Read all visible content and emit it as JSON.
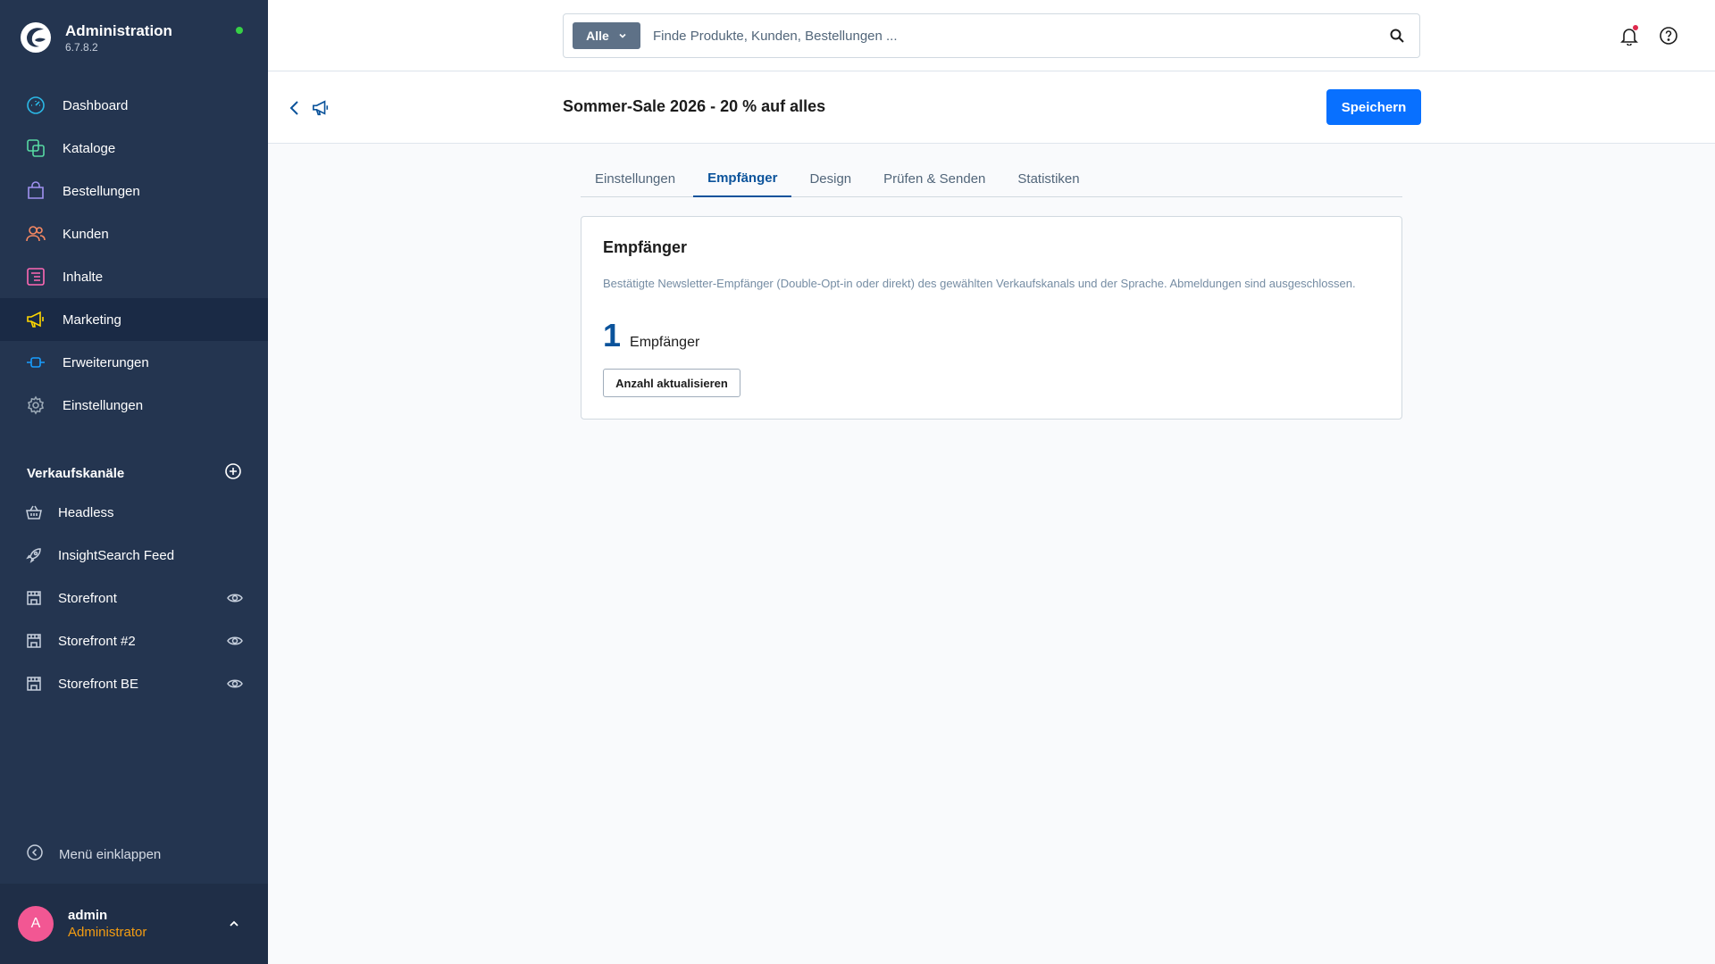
{
  "brand": {
    "title": "Administration",
    "version": "6.7.8.2",
    "status_color": "#37d046"
  },
  "nav": [
    {
      "label": "Dashboard",
      "icon": "gauge-icon",
      "color": "#2bb8e6",
      "active": false
    },
    {
      "label": "Kataloge",
      "icon": "products-icon",
      "color": "#57d9a3",
      "active": false
    },
    {
      "label": "Bestellungen",
      "icon": "shopping-bag-icon",
      "color": "#a092f0",
      "active": false
    },
    {
      "label": "Kunden",
      "icon": "users-icon",
      "color": "#f88962",
      "active": false
    },
    {
      "label": "Inhalte",
      "icon": "content-icon",
      "color": "#ff68b4",
      "active": false
    },
    {
      "label": "Marketing",
      "icon": "megaphone-icon",
      "color": "#ffd700",
      "active": true
    },
    {
      "label": "Erweiterungen",
      "icon": "plug-icon",
      "color": "#189eff",
      "active": false
    },
    {
      "label": "Einstellungen",
      "icon": "gear-icon",
      "color": "#9aa8b5",
      "active": false
    }
  ],
  "sales_channels": {
    "title": "Verkaufskanäle",
    "items": [
      {
        "label": "Headless",
        "icon": "basket-icon",
        "preview": false
      },
      {
        "label": "InsightSearch Feed",
        "icon": "rocket-icon",
        "preview": false
      },
      {
        "label": "Storefront",
        "icon": "storefront-icon",
        "preview": true
      },
      {
        "label": "Storefront #2",
        "icon": "storefront-icon",
        "preview": true
      },
      {
        "label": "Storefront BE",
        "icon": "storefront-icon",
        "preview": true
      }
    ]
  },
  "collapse": {
    "label": "Menü einklappen"
  },
  "user": {
    "initial": "A",
    "name": "admin",
    "role": "Administrator",
    "avatar_color": "#f25793",
    "role_color": "#f39c12"
  },
  "search": {
    "type_label": "Alle",
    "placeholder": "Finde Produkte, Kunden, Bestellungen ..."
  },
  "smartbar": {
    "title": "Sommer-Sale 2026 - 20 % auf alles",
    "save_label": "Speichern"
  },
  "tabs": [
    {
      "label": "Einstellungen",
      "active": false
    },
    {
      "label": "Empfänger",
      "active": true
    },
    {
      "label": "Design",
      "active": false
    },
    {
      "label": "Prüfen & Senden",
      "active": false
    },
    {
      "label": "Statistiken",
      "active": false
    }
  ],
  "card": {
    "title": "Empfänger",
    "description": "Bestätigte Newsletter-Empfänger (Double-Opt-in oder direkt) des gewählten Verkaufskanals und der Sprache. Abmeldungen sind ausgeschlossen.",
    "count": "1",
    "count_label": "Empfänger",
    "refresh_label": "Anzahl aktualisieren"
  }
}
